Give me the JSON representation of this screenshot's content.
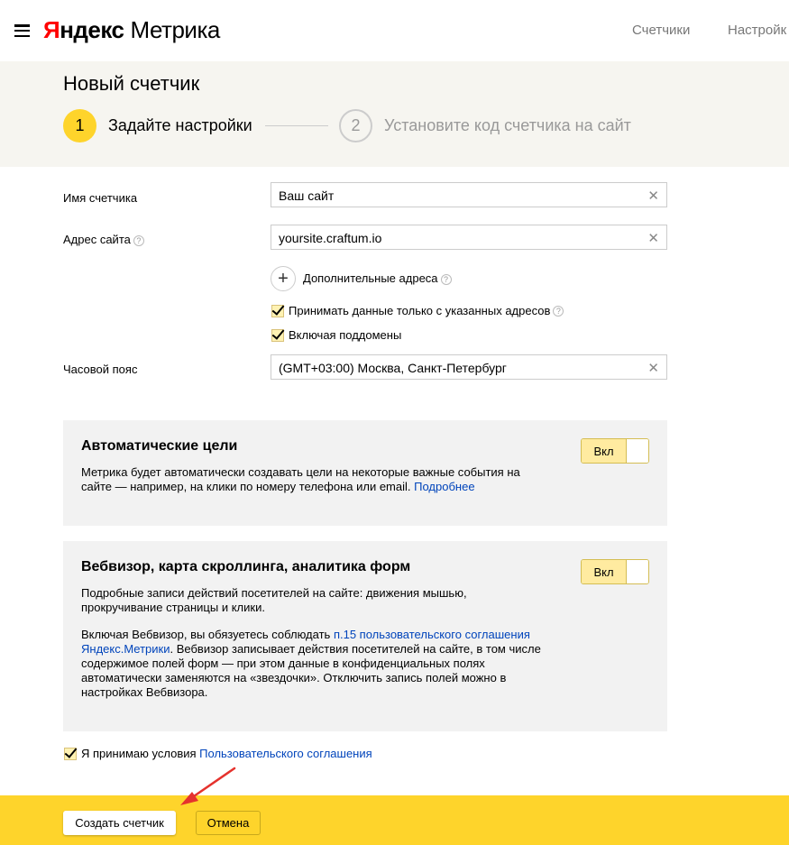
{
  "header": {
    "logo_ya": "Я",
    "logo_rest": "ндекс",
    "logo_metrika": "Метрика",
    "nav": [
      "Счетчики",
      "Настройк"
    ]
  },
  "page_head": {
    "title": "Новый счетчик",
    "steps": [
      {
        "number": "1",
        "label": "Задайте настройки"
      },
      {
        "number": "2",
        "label": "Установите код счетчика на сайт"
      }
    ]
  },
  "form": {
    "name_label": "Имя счетчика",
    "name_value": "Ваш сайт",
    "address_label": "Адрес сайта",
    "address_value": "yoursite.craftum.io",
    "add_more_label": "Дополнительные адреса",
    "accept_only_label": "Принимать данные только с указанных адресов",
    "subdomains_label": "Включая поддомены",
    "timezone_label": "Часовой пояс",
    "timezone_value": "(GMT+03:00) Москва, Санкт-Петербург",
    "clear_glyph": "✕",
    "help_glyph": "?"
  },
  "auto_goals": {
    "title": "Автоматические цели",
    "text": "Метрика будет автоматически создавать цели на некоторые важные события на сайте — например, на клики по номеру телефона или email.",
    "link": "Подробнее",
    "toggle_label": "Вкл"
  },
  "webvisor": {
    "title": "Вебвизор, карта скроллинга, аналитика форм",
    "text1": "Подробные записи действий посетителей на сайте: движения мышью, прокручивание страницы и клики.",
    "text2_before": "Включая Вебвизор, вы обязуетесь соблюдать",
    "text2_link": "п.15 пользовательского соглашения Яндекс.Метрики",
    "text2_after": ". Вебвизор записывает действия посетителей на сайте, в том числе содержимое полей форм — при этом данные в конфиденциальных полях автоматически заменяются на «звездочки». Отключить запись полей можно в настройках Вебвизора.",
    "toggle_label": "Вкл"
  },
  "agreement": {
    "text": "Я принимаю условия",
    "link": "Пользовательского соглашения"
  },
  "footer": {
    "create_label": "Создать счетчик",
    "cancel_label": "Отмена"
  },
  "colors": {
    "accent_yellow": "#fed42b",
    "logo_red": "#ff0000",
    "link_blue": "#0044bb",
    "arrow_red": "#e5322d"
  }
}
